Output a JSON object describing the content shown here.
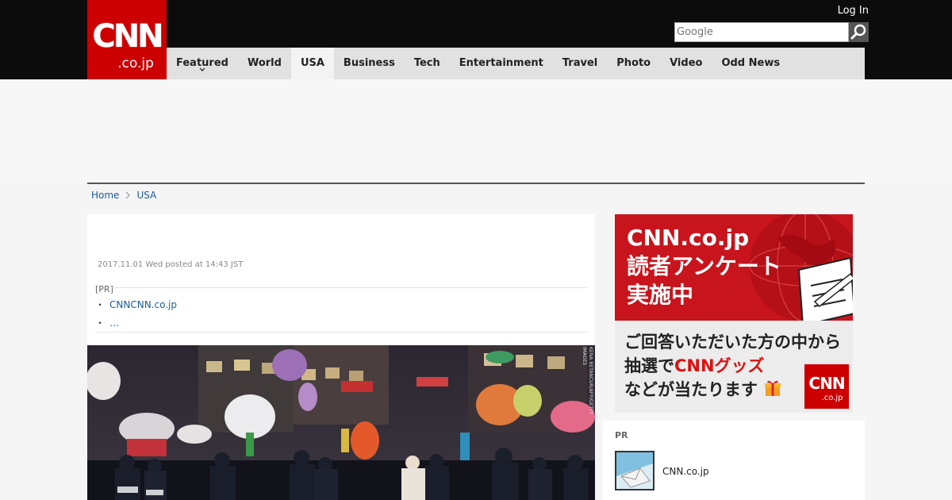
{
  "header": {
    "logo_top": "CNN",
    "logo_bottom": ".co.jp",
    "login_label": "Log In",
    "search_placeholder": "Google"
  },
  "nav": {
    "items": [
      {
        "label": "Featured",
        "has_dropdown": true
      },
      {
        "label": "World"
      },
      {
        "label": "USA",
        "active": true
      },
      {
        "label": "Business"
      },
      {
        "label": "Tech"
      },
      {
        "label": "Entertainment"
      },
      {
        "label": "Travel"
      },
      {
        "label": "Photo"
      },
      {
        "label": "Video"
      },
      {
        "label": "Odd News"
      }
    ]
  },
  "breadcrumb": {
    "home": "Home",
    "current": "USA"
  },
  "article": {
    "date": "2017.11.01 Wed posted at 14:43 JST",
    "pr_label": "[PR]",
    "pr_links": [
      "CNNCNN.co.jp",
      "…"
    ],
    "photo_credit": "KENA BETANCUR/AFP/GETTY IMAGES"
  },
  "sidebar_banner": {
    "title": "CNN.co.jp",
    "line2": "読者アンケート",
    "line3": "実施中",
    "bottom_line1": "ご回答いただいた方の中から",
    "bottom_line2_pre": "抽選で",
    "bottom_line2_red": "CNNグッズ",
    "bottom_line3": "などが当たります",
    "mini_logo_top": "CNN",
    "mini_logo_bottom": ".co.jp"
  },
  "sidebar_pr": {
    "heading": "PR",
    "item_label": "CNN.co.jp"
  },
  "colors": {
    "brand_red": "#cc0000",
    "link_blue": "#1a5a96",
    "topbar": "#0c0c0c",
    "nav_bg": "#e1e1e1"
  },
  "icons": {
    "search": "magnifier-icon",
    "breadcrumb_separator": "chevron-right-icon",
    "nav_dropdown": "chevron-down-icon",
    "banner_gift": "gift-icon"
  }
}
